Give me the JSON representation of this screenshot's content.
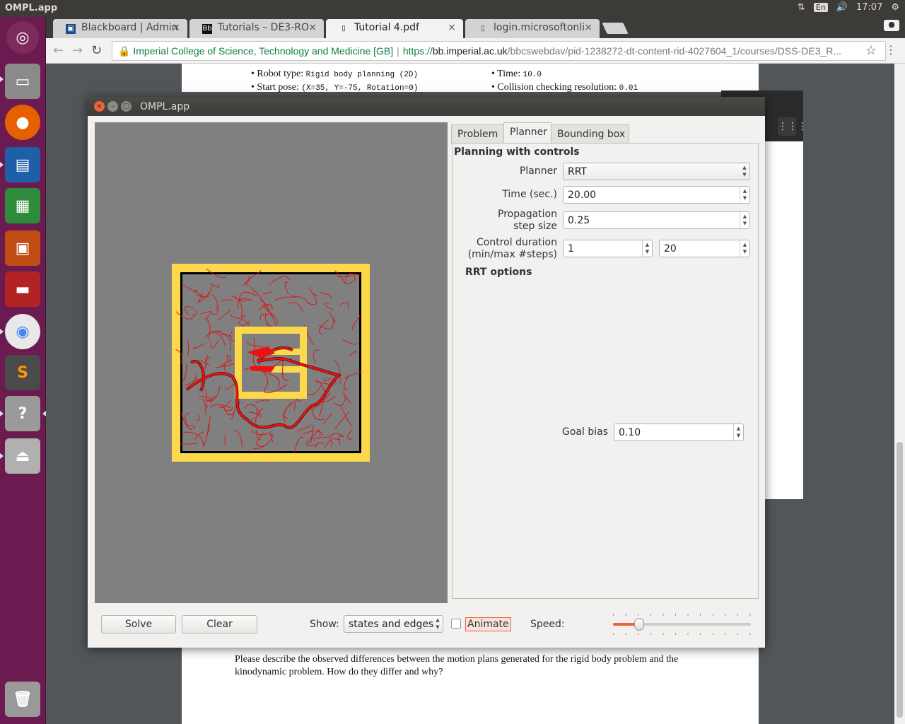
{
  "top_panel": {
    "app_title": "OMPL.app",
    "keyboard": "En",
    "clock": "17:07"
  },
  "launcher": {
    "items": [
      "ubuntu-dash",
      "files",
      "firefox",
      "libreoffice-writer",
      "libreoffice-calc",
      "libreoffice-impress",
      "terminal-app",
      "chrome",
      "sublime-text",
      "help",
      "usb-drive",
      "trash"
    ]
  },
  "browser": {
    "tabs": [
      {
        "title": "Blackboard | Admin",
        "icon": "blackboard-icon"
      },
      {
        "title": "Tutorials – DE3-RO",
        "icon": "bb-icon"
      },
      {
        "title": "Tutorial 4.pdf",
        "icon": "page-icon"
      },
      {
        "title": "login.microsoftonli",
        "icon": "page-icon"
      }
    ],
    "address": {
      "org": "Imperial College of Science, Technology and Medicine [GB]",
      "scheme": "https://",
      "host": "bb.imperial.ac.uk",
      "path": "/bbcswebdav/pid-1238272-dt-content-rid-4027604_1/courses/DSS-DE3_R..."
    }
  },
  "pdf": {
    "bullet1_label": "Robot type:",
    "bullet1_value": "Rigid body planning (2D)",
    "bullet2_label": "Start pose:",
    "bullet2_value": "(X=35, Y=-75, Rotation=0)",
    "bullet3_label": "Time:",
    "bullet3_value": "10.0",
    "bullet4_label": "Collision checking resolution:",
    "bullet4_value": "0.01",
    "question": "Please describe the observed differences between the motion plans generated for the rigid body problem and the kinodynamic problem. How do they differ and why?"
  },
  "ompl": {
    "window_title": "OMPL.app",
    "tabs": [
      "Problem",
      "Planner",
      "Bounding box"
    ],
    "active_tab": "Planner",
    "heading": "Planning with controls",
    "planner_label": "Planner",
    "planner_value": "RRT",
    "time_label": "Time (sec.)",
    "time_value": "20.00",
    "prop_label_1": "Propagation",
    "prop_label_2": "step size",
    "prop_value": "0.25",
    "ctrl_label_1": "Control duration",
    "ctrl_label_2": "(min/max #steps)",
    "ctrl_min": "1",
    "ctrl_max": "20",
    "rrt_heading": "RRT options",
    "goal_bias_label": "Goal bias",
    "goal_bias_value": "0.10",
    "solve_label": "Solve",
    "clear_label": "Clear",
    "show_label": "Show:",
    "show_value": "states and edges",
    "animate_label": "Animate",
    "animate_checked": false,
    "speed_label": "Speed:",
    "speed_fraction": 0.19,
    "colors": {
      "obstacle": "#fcd84a",
      "tree": "#dd1111",
      "path": "#000000",
      "viewport": "#808080"
    }
  }
}
